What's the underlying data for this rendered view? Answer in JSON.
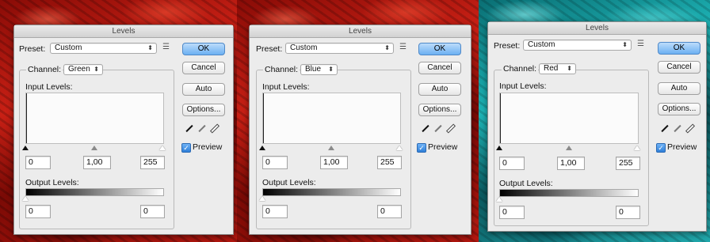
{
  "dialogs": [
    {
      "title": "Levels",
      "preset_label": "Preset:",
      "preset_value": "Custom",
      "channel_label": "Channel:",
      "channel_value": "Green",
      "input_levels_label": "Input Levels:",
      "input_black": "0",
      "input_gamma": "1,00",
      "input_white": "255",
      "output_levels_label": "Output Levels:",
      "output_black": "0",
      "output_white": "0",
      "ok_label": "OK",
      "cancel_label": "Cancel",
      "auto_label": "Auto",
      "options_label": "Options...",
      "preview_label": "Preview",
      "preview_checked": true,
      "background": "red"
    },
    {
      "title": "Levels",
      "preset_label": "Preset:",
      "preset_value": "Custom",
      "channel_label": "Channel:",
      "channel_value": "Blue",
      "input_levels_label": "Input Levels:",
      "input_black": "0",
      "input_gamma": "1,00",
      "input_white": "255",
      "output_levels_label": "Output Levels:",
      "output_black": "0",
      "output_white": "0",
      "ok_label": "OK",
      "cancel_label": "Cancel",
      "auto_label": "Auto",
      "options_label": "Options...",
      "preview_label": "Preview",
      "preview_checked": true,
      "background": "red"
    },
    {
      "title": "Levels",
      "preset_label": "Preset:",
      "preset_value": "Custom",
      "channel_label": "Channel:",
      "channel_value": "Red",
      "input_levels_label": "Input Levels:",
      "input_black": "0",
      "input_gamma": "1,00",
      "input_white": "255",
      "output_levels_label": "Output Levels:",
      "output_black": "0",
      "output_white": "0",
      "ok_label": "OK",
      "cancel_label": "Cancel",
      "auto_label": "Auto",
      "options_label": "Options...",
      "preview_label": "Preview",
      "preview_checked": true,
      "background": "teal"
    }
  ],
  "icons": {
    "select_arrow": "updown-arrows-icon",
    "preset_menu": "preset-options-menu-icon",
    "eyedroppers": [
      "black-point-eyedropper-icon",
      "gray-point-eyedropper-icon",
      "white-point-eyedropper-icon"
    ]
  },
  "colors": {
    "dialog_bg": "#ececec",
    "ok_button": "#6cb0f2",
    "background_red": "#c92015",
    "background_teal": "#1eb5b7"
  }
}
